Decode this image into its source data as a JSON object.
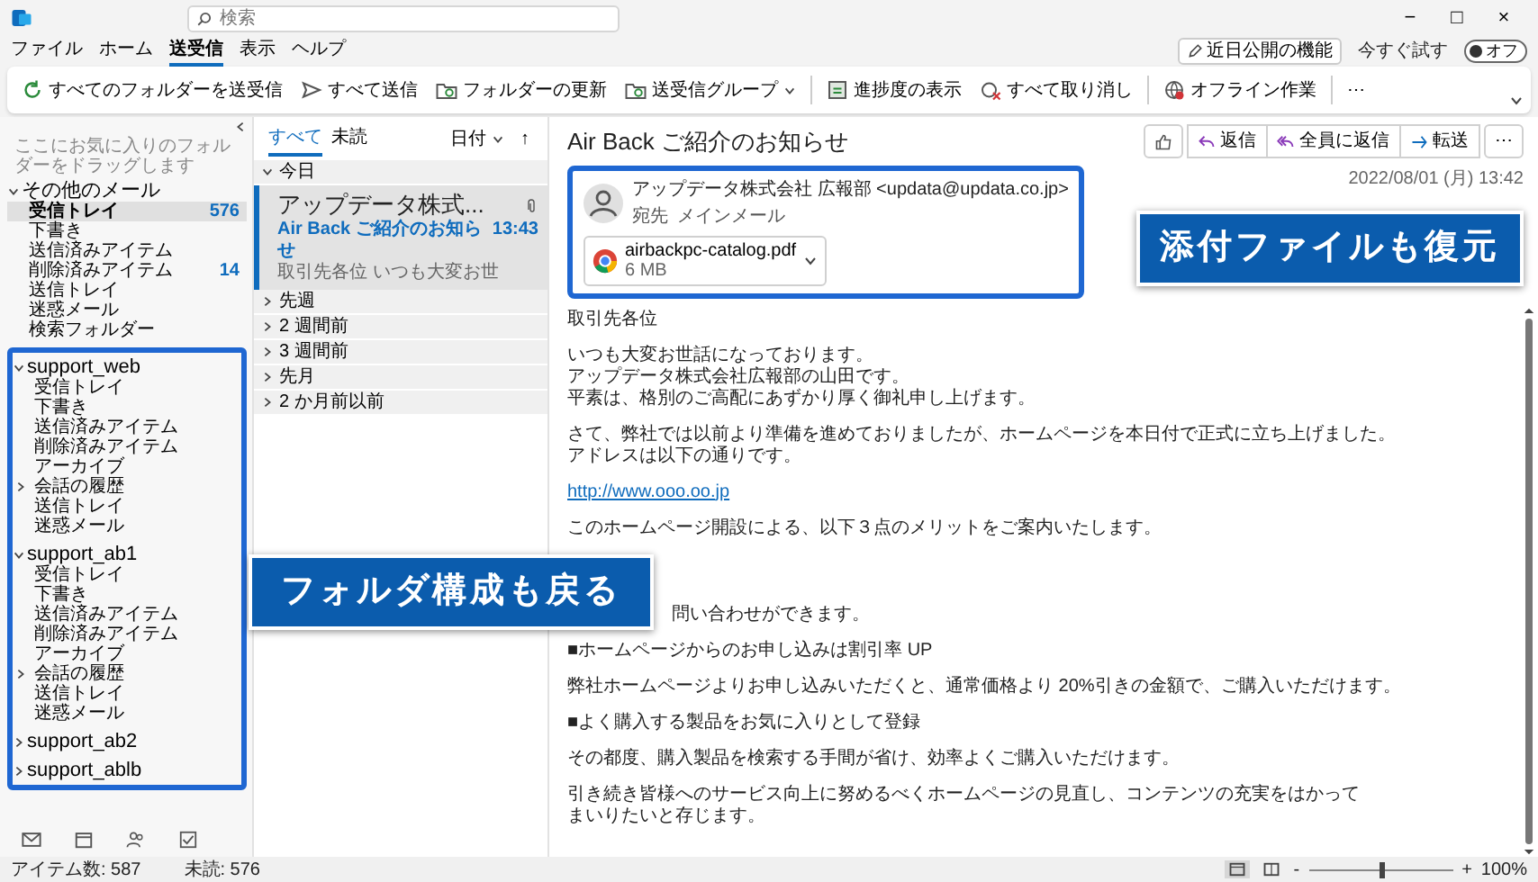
{
  "title_bar": {
    "search": {
      "placeholder": "検索"
    },
    "controls": [
      "−",
      "□",
      "×"
    ]
  },
  "menu": {
    "tabs": [
      {
        "label": "ファイル",
        "selected": false
      },
      {
        "label": "ホーム",
        "selected": false
      },
      {
        "label": "送受信",
        "selected": true
      },
      {
        "label": "表示",
        "selected": false
      },
      {
        "label": "ヘルプ",
        "selected": false
      }
    ],
    "coming_soon": "近日公開の機能",
    "try_now": "今すぐ試す",
    "toggle": {
      "label": "オフ",
      "on": false
    }
  },
  "ribbon": {
    "buttons": [
      {
        "label": "すべてのフォルダーを送受信",
        "dropdown": false
      },
      {
        "label": "すべて送信",
        "dropdown": false
      },
      {
        "label": "フォルダーの更新",
        "dropdown": false
      },
      {
        "label": "送受信グループ",
        "dropdown": true
      },
      {
        "label": "進捗度の表示",
        "dropdown": false
      },
      {
        "label": "すべて取り消し",
        "dropdown": false
      },
      {
        "label": "オフライン作業",
        "dropdown": false
      }
    ],
    "more": "⋯"
  },
  "folder_pane": {
    "favorites_hint": "ここにお気に入りのフォルダーをドラッグします",
    "accounts": [
      {
        "name": "その他のメール",
        "expanded": true,
        "framed": false,
        "folders": [
          {
            "name": "受信トレイ",
            "selected": true,
            "count": "576"
          },
          {
            "name": "下書き",
            "selected": false
          },
          {
            "name": "送信済みアイテム",
            "selected": false
          },
          {
            "name": "削除済みアイテム",
            "selected": false,
            "count": "14"
          },
          {
            "name": "送信トレイ",
            "selected": false
          },
          {
            "name": "迷惑メール",
            "selected": false
          },
          {
            "name": "検索フォルダー",
            "selected": false
          }
        ]
      },
      {
        "name": "support_web",
        "expanded": true,
        "framed": true,
        "folders": [
          {
            "name": "受信トレイ",
            "selected": false
          },
          {
            "name": "下書き",
            "selected": false
          },
          {
            "name": "送信済みアイテム",
            "selected": false
          },
          {
            "name": "削除済みアイテム",
            "selected": false
          },
          {
            "name": "アーカイブ",
            "selected": false
          },
          {
            "name": "会話の履歴",
            "selected": false,
            "expanded": false
          },
          {
            "name": "送信トレイ",
            "selected": false
          },
          {
            "name": "迷惑メール",
            "selected": false
          }
        ]
      },
      {
        "name": "support_ab1",
        "expanded": true,
        "framed": true,
        "folders": [
          {
            "name": "受信トレイ",
            "selected": false
          },
          {
            "name": "下書き",
            "selected": false
          },
          {
            "name": "送信済みアイテム",
            "selected": false
          },
          {
            "name": "削除済みアイテム",
            "selected": false
          },
          {
            "name": "アーカイブ",
            "selected": false
          },
          {
            "name": "会話の履歴",
            "selected": false,
            "expanded": false
          },
          {
            "name": "送信トレイ",
            "selected": false
          },
          {
            "name": "迷惑メール",
            "selected": false
          }
        ]
      },
      {
        "name": "support_ab2",
        "expanded": false,
        "framed": true
      },
      {
        "name": "support_ablb",
        "expanded": false,
        "framed": true
      }
    ]
  },
  "message_list": {
    "filters": [
      {
        "label": "すべて",
        "selected": true
      },
      {
        "label": "未読",
        "selected": false
      }
    ],
    "sort": "日付",
    "sort_direction": "↑",
    "groups": [
      {
        "label": "今日",
        "expanded": true,
        "messages": [
          {
            "sender": "アップデータ株式...",
            "subject": "Air Back ご紹介のお知らせ",
            "preview": "取引先各位 いつも大変お世",
            "time": "13:43",
            "selected": true,
            "unread": true
          }
        ]
      },
      {
        "label": "先週",
        "expanded": false
      },
      {
        "label": "2 週間前",
        "expanded": false
      },
      {
        "label": "3 週間前",
        "expanded": false
      },
      {
        "label": "先月",
        "expanded": false
      },
      {
        "label": "2 か月前以前",
        "expanded": false
      }
    ]
  },
  "reading_pane": {
    "subject": "Air Back ご紹介のお知らせ",
    "actions": [
      "返信",
      "全員に返信",
      "転送"
    ],
    "more": "⋯",
    "sender": "アップデータ株式会社  広報部 <updata@updata.co.jp>",
    "to_label": "宛先",
    "to": "メインメール",
    "attachment": {
      "name": "airbackpc-catalog.pdf",
      "size": "6 MB"
    },
    "date": "2022/08/01 (月) 13:42",
    "body": [
      {
        "kind": "text",
        "lines": [
          "取引先各位"
        ]
      },
      {
        "kind": "text",
        "lines": [
          "いつも大変お世話になっております。",
          "アップデータ株式会社広報部の山田です。",
          "平素は、格別のご高配にあずかり厚く御礼申し上げます。"
        ]
      },
      {
        "kind": "text",
        "lines": [
          "さて、弊社では以前より準備を進めておりましたが、ホームページを本日付で正式に立ち上げました。",
          "アドレスは以下の通りです。"
        ]
      },
      {
        "kind": "link",
        "lines": [
          "http://www.ooo.oo.jp"
        ]
      },
      {
        "kind": "text",
        "lines": [
          "このホームページ開設による、以下３点のメリットをご案内いたします。"
        ]
      },
      {
        "kind": "covered",
        "lines": [
          "問い合わせができます。"
        ]
      },
      {
        "kind": "text",
        "lines": [
          "■ホームページからのお申し込みは割引率 UP"
        ]
      },
      {
        "kind": "text",
        "lines": [
          "弊社ホームページよりお申し込みいただくと、通常価格より 20%引きの金額で、ご購入いただけます。"
        ]
      },
      {
        "kind": "text",
        "lines": [
          "■よく購入する製品をお気に入りとして登録"
        ]
      },
      {
        "kind": "text",
        "lines": [
          "その都度、購入製品を検索する手間が省け、効率よくご購入いただけます。"
        ]
      },
      {
        "kind": "text",
        "lines": [
          "引き続き皆様へのサービス向上に努めるべくホームページの見直し、コンテンツの充実をはかって",
          "まいりたいと存じます。"
        ]
      }
    ]
  },
  "callouts": [
    {
      "text": "添付ファイルも復元"
    },
    {
      "text": "フォルダ構成も戻る"
    }
  ],
  "status_bar": {
    "items": "アイテム数: 587",
    "unread": "未読: 576",
    "views": [
      {
        "selected": true
      },
      {
        "selected": false
      }
    ],
    "zoom": {
      "minus": "-",
      "plus": "+",
      "level": 0.5,
      "reading": "100%"
    }
  }
}
